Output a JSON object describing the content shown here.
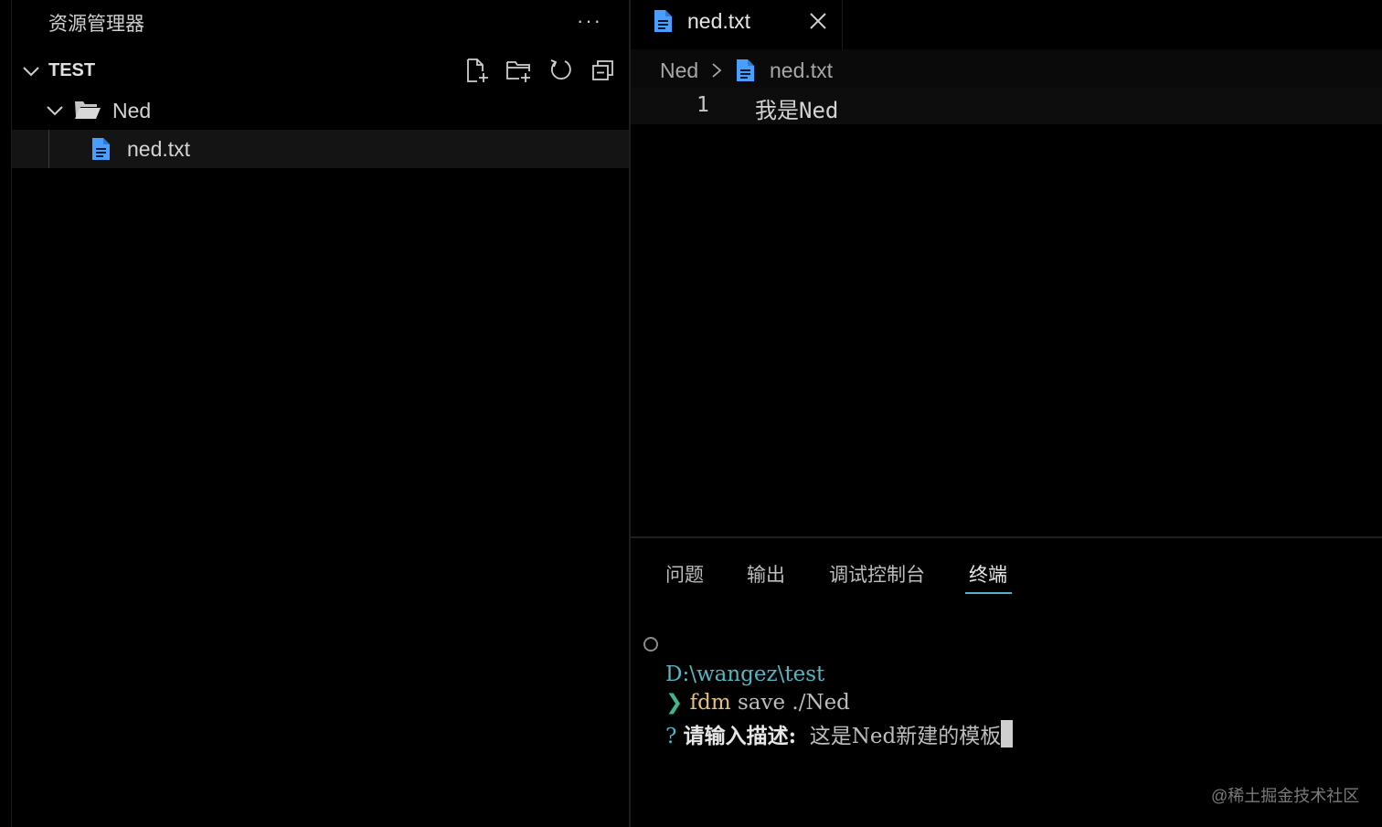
{
  "sidebar": {
    "title": "资源管理器",
    "more_label": "···",
    "section": {
      "title": "TEST",
      "toolbar": [
        "new-file-icon",
        "new-folder-icon",
        "refresh-icon",
        "collapse-all-icon"
      ]
    },
    "tree": {
      "folder": "Ned",
      "file": "ned.txt"
    }
  },
  "editor": {
    "tab": {
      "label": "ned.txt"
    },
    "breadcrumb": {
      "folder": "Ned",
      "file": "ned.txt"
    },
    "lines": [
      {
        "number": "1",
        "text": "我是Ned"
      }
    ]
  },
  "panel": {
    "tabs": [
      "问题",
      "输出",
      "调试控制台",
      "终端"
    ],
    "active_tab": "终端",
    "terminal": {
      "path": "D:\\wangez\\test",
      "prompt_symbol": "❯",
      "command": "fdm",
      "args": " save ./Ned",
      "question_mark": "?",
      "question": "请输入描述:",
      "answer": "这是Ned新建的模板"
    }
  },
  "watermark": "@稀土掘金技术社区",
  "colors": {
    "accent": "#4fb3c9",
    "file_icon": "#4a9eff",
    "folder_icon": "#c5c5c5",
    "path": "#56b6c2",
    "command": "#e5c07b",
    "prompt": "#3fb68b"
  }
}
